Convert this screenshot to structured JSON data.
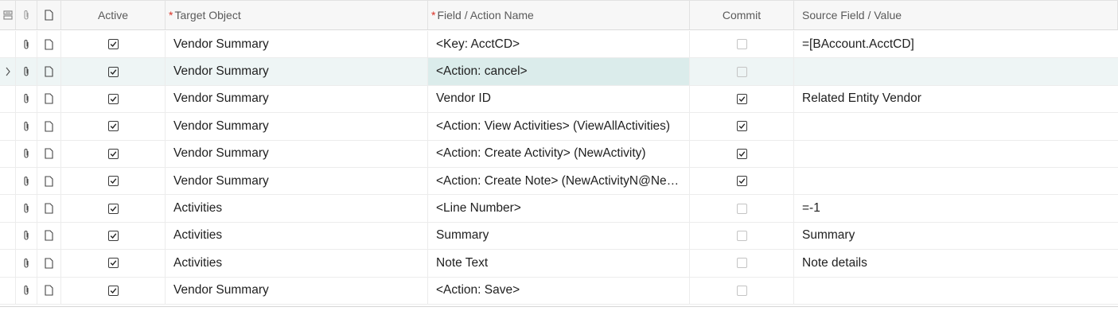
{
  "columns": {
    "active": "Active",
    "target_object": "Target Object",
    "field_action_name": "Field / Action Name",
    "commit": "Commit",
    "source_field_value": "Source Field / Value",
    "required_marker": "*"
  },
  "icons": {
    "header_row_selector": "rows-icon",
    "attachment": "paperclip-icon",
    "note": "document-icon",
    "current_row": "chevron-right-icon",
    "checked": "checkbox-checked-icon",
    "unchecked": "checkbox-empty-icon"
  },
  "colors": {
    "selected_row": "#eef5f5",
    "selected_cell": "#dbeceb",
    "required": "#d93025"
  },
  "rows": [
    {
      "active": true,
      "target_object": "Vendor Summary",
      "field_action_name": "<Key: AcctCD>",
      "commit": false,
      "source_field_value": "=[BAccount.AcctCD]"
    },
    {
      "active": true,
      "target_object": "Vendor Summary",
      "field_action_name": "<Action: cancel>",
      "commit": false,
      "source_field_value": "",
      "current": true
    },
    {
      "active": true,
      "target_object": "Vendor Summary",
      "field_action_name": "Vendor ID",
      "commit": true,
      "source_field_value": "Related Entity Vendor"
    },
    {
      "active": true,
      "target_object": "Vendor Summary",
      "field_action_name": "<Action: View Activities> (ViewAllActivities)",
      "commit": true,
      "source_field_value": ""
    },
    {
      "active": true,
      "target_object": "Vendor Summary",
      "field_action_name": "<Action: Create Activity> (NewActivity)",
      "commit": true,
      "source_field_value": ""
    },
    {
      "active": true,
      "target_object": "Vendor Summary",
      "field_action_name": "<Action: Create Note> (NewActivityN@Ne…",
      "commit": true,
      "source_field_value": ""
    },
    {
      "active": true,
      "target_object": "Activities",
      "field_action_name": "<Line Number>",
      "commit": false,
      "source_field_value": "=-1"
    },
    {
      "active": true,
      "target_object": "Activities",
      "field_action_name": "Summary",
      "commit": false,
      "source_field_value": "Summary"
    },
    {
      "active": true,
      "target_object": "Activities",
      "field_action_name": "Note Text",
      "commit": false,
      "source_field_value": "Note details"
    },
    {
      "active": true,
      "target_object": "Vendor Summary",
      "field_action_name": "<Action: Save>",
      "commit": false,
      "source_field_value": ""
    }
  ]
}
